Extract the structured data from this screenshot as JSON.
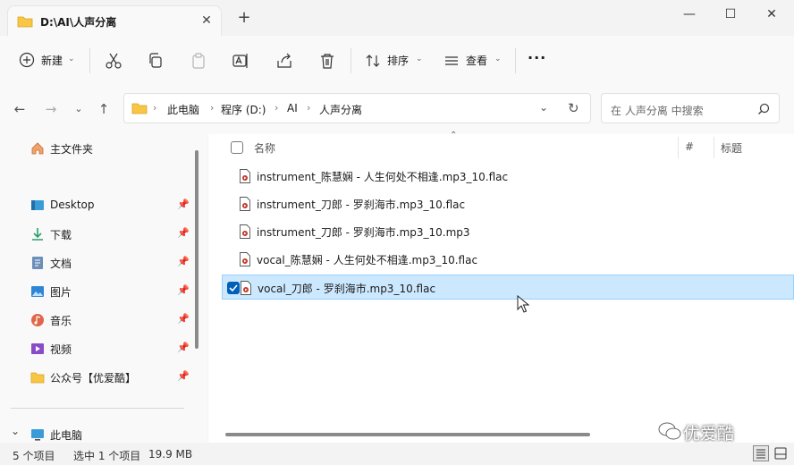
{
  "window": {
    "tab_title": "D:\\AI\\人声分离",
    "tab_close": "✕",
    "new_tab": "+",
    "minimize": "—",
    "maximize": "☐",
    "close": "✕"
  },
  "toolbar": {
    "new_label": "新建",
    "sort_label": "排序",
    "view_label": "查看",
    "more_label": "···"
  },
  "address": {
    "crumbs": [
      "此电脑",
      "程序 (D:)",
      "AI",
      "人声分离"
    ],
    "separator": "›"
  },
  "search": {
    "placeholder": "在 人声分离 中搜索"
  },
  "sidebar": {
    "items": [
      {
        "label": "主文件夹",
        "icon": "home-icon"
      },
      {
        "label": "Desktop",
        "icon": "desktop-icon",
        "pinned": true
      },
      {
        "label": "下载",
        "icon": "download-icon",
        "pinned": true
      },
      {
        "label": "文档",
        "icon": "document-icon",
        "pinned": true
      },
      {
        "label": "图片",
        "icon": "picture-icon",
        "pinned": true
      },
      {
        "label": "音乐",
        "icon": "music-icon",
        "pinned": true
      },
      {
        "label": "视频",
        "icon": "video-icon",
        "pinned": true
      },
      {
        "label": "公众号【优爱酷】",
        "icon": "folder-icon",
        "pinned": true
      },
      {
        "label": "此电脑",
        "icon": "computer-icon"
      }
    ],
    "pin_glyph": "📌",
    "expand_glyph": "⌄"
  },
  "columns": {
    "name": "名称",
    "number": "#",
    "title": "标题",
    "sort_glyph": "⌃"
  },
  "files": [
    {
      "name": "instrument_陈慧娴 - 人生何处不相逢.mp3_10.flac",
      "selected": false
    },
    {
      "name": "instrument_刀郎 - 罗刹海市.mp3_10.flac",
      "selected": false
    },
    {
      "name": "instrument_刀郎 - 罗刹海市.mp3_10.mp3",
      "selected": false
    },
    {
      "name": "vocal_陈慧娴 - 人生何处不相逢.mp3_10.flac",
      "selected": false
    },
    {
      "name": "vocal_刀郎 - 罗刹海市.mp3_10.flac",
      "selected": true
    }
  ],
  "status": {
    "count": "5 个项目",
    "selected": "选中 1 个项目",
    "size": "19.9 MB"
  },
  "watermark": "优爱酷",
  "colors": {
    "accent": "#005fb8",
    "selection_bg": "#cce8ff",
    "folder": "#f8c544"
  }
}
